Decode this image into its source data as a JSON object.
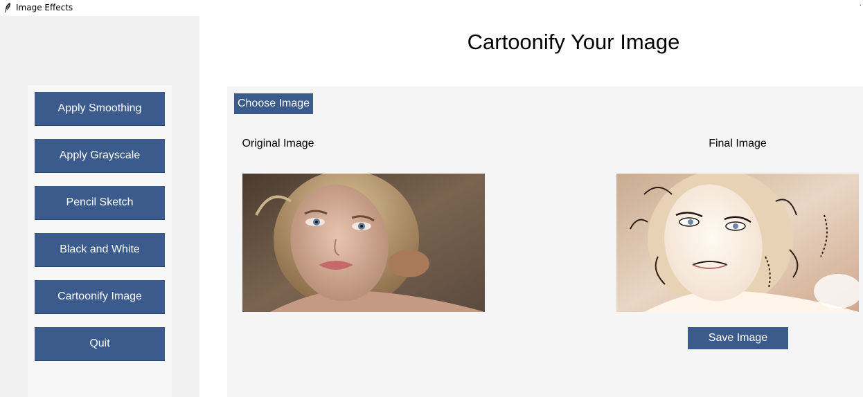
{
  "window": {
    "title": "Image Effects",
    "icon": "feather-icon"
  },
  "sidebar": {
    "buttons": [
      {
        "label": "Apply Smoothing"
      },
      {
        "label": "Apply Grayscale"
      },
      {
        "label": "Pencil Sketch"
      },
      {
        "label": "Black and White"
      },
      {
        "label": "Cartoonify Image"
      },
      {
        "label": "Quit"
      }
    ]
  },
  "main": {
    "title": "Cartoonify Your Image",
    "choose_label": "Choose Image",
    "original_label": "Original Image",
    "final_label": "Final Image",
    "save_label": "Save Image"
  },
  "colors": {
    "button_bg": "#3b5b8c",
    "button_text": "#ffffff",
    "sidebar_bg": "#f0f0f0",
    "workarea_bg": "#f5f5f5"
  }
}
